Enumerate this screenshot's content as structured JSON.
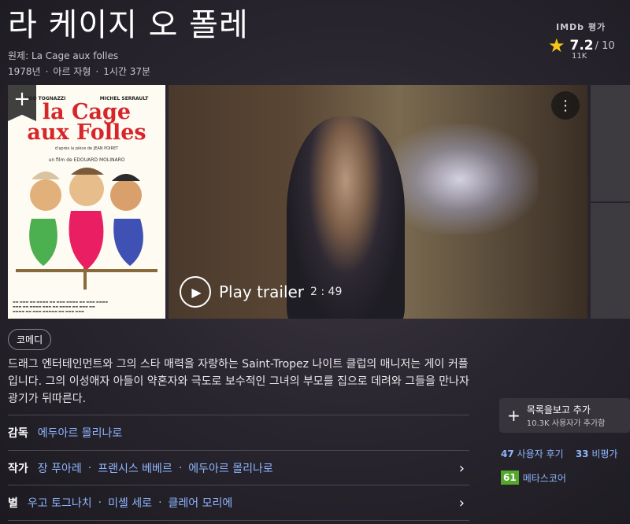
{
  "header": {
    "title": "라 케이지 오 폴레",
    "original_title": "원제: La Cage aux folles",
    "year": "1978년",
    "rating_cert": "아르 자형",
    "runtime": "1시간 37분"
  },
  "imdb": {
    "label": "IMDb 평가",
    "score": "7.2",
    "out_of": "/ 10",
    "votes": "11K",
    "star_color": "#f5c518"
  },
  "poster": {
    "cast_left": "UGO TOGNAZZI",
    "cast_right": "MICHEL SERRAULT",
    "title_line1": "la Cage",
    "title_line2": "aux Folles",
    "subtitle": "d'après la pièce de JEAN POIRET",
    "director": "un film de EDOUARD MOLINARO",
    "add_icon": "plus-icon"
  },
  "video": {
    "play_label": "Play trailer",
    "duration": "2 : 49",
    "menu_icon": "more-vertical-icon"
  },
  "genres": [
    "코메디"
  ],
  "plot": "드래그 엔터테인먼트와 그의 스타 매력을 자랑하는 Saint-Tropez 나이트 클럽의 매니저는 게이 커플입니다. 그의 이성애자 아들이 약혼자와 극도로 보수적인 그녀의 부모를 집으로 데려와 그들을 만나자 광기가 뒤따른다.",
  "credits": {
    "director_label": "감독",
    "directors": [
      "에두아르 몰리나로"
    ],
    "writer_label": "작가",
    "writers": [
      "장 푸아레",
      "프랜시스 베베르",
      "에두아르 몰리나로"
    ],
    "stars_label": "별",
    "stars": [
      "우고 토그나치",
      "미셸 세로",
      "클레어 모리에"
    ]
  },
  "sidebar": {
    "watchlist_label": "목록을보고 추가",
    "watchlist_count": "10.3K 사용자가 추가함",
    "user_reviews_count": "47",
    "user_reviews_label": "사용자 후기",
    "critic_reviews_count": "33",
    "critic_reviews_label": "비평가",
    "metascore": "61",
    "metascore_label": "메타스코어",
    "metascore_color": "#54a72a"
  }
}
